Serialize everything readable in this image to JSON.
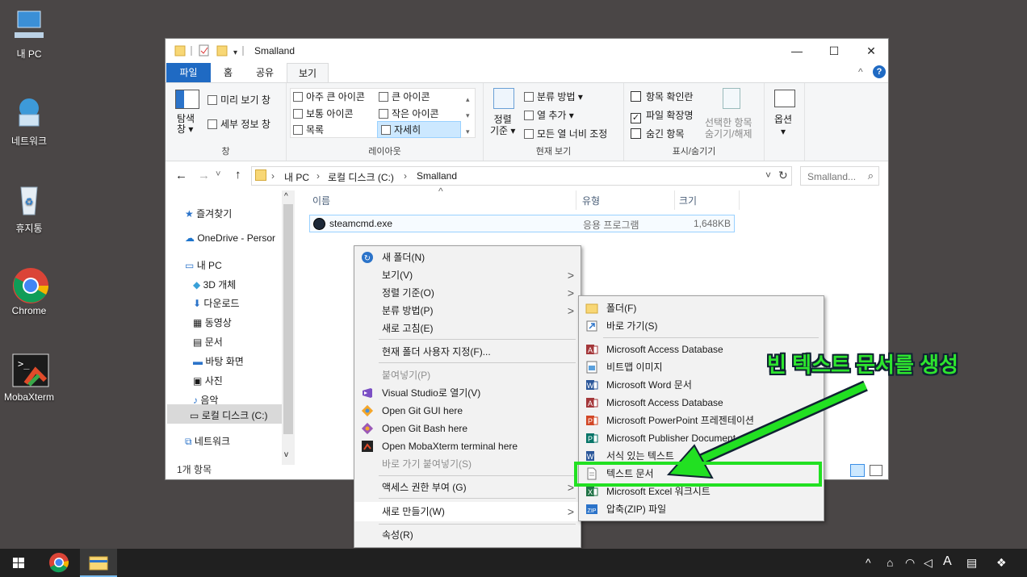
{
  "desktop": {
    "icons": [
      {
        "label": "내 PC"
      },
      {
        "label": "네트워크"
      },
      {
        "label": "휴지통"
      },
      {
        "label": "Chrome"
      },
      {
        "label": "MobaXterm"
      }
    ]
  },
  "window": {
    "title": "Smalland",
    "controls": {
      "minimize": "—",
      "maximize": "☐",
      "close": "✕"
    },
    "tabs": {
      "file": "파일",
      "home": "홈",
      "share": "공유",
      "view": "보기"
    },
    "ribbon": {
      "pane": {
        "nav_pane": "탐색\n창 ▾",
        "preview": "미리 보기 창",
        "details": "세부 정보 창",
        "label": "창"
      },
      "layout": {
        "items": [
          "아주 큰 아이콘",
          "큰 아이콘",
          "보통 아이콘",
          "작은 아이콘",
          "목록",
          "자세히"
        ],
        "label": "레이아웃"
      },
      "current_view": {
        "sort": "정렬\n기준 ▾",
        "group": "분류 방법 ▾",
        "add_col": "열 추가 ▾",
        "fit_cols": "모든 열 너비 조정",
        "label": "현재 보기"
      },
      "show_hide": {
        "item_check": "항목 확인란",
        "file_ext": "파일 확장명",
        "hidden": "숨긴 항목",
        "hide_selected": "선택한 항목\n숨기기/해제",
        "label": "표시/숨기기"
      },
      "options": {
        "label": "옵션\n▾"
      }
    },
    "address": {
      "path": [
        "내 PC",
        "로컬 디스크 (C:)",
        "Smalland"
      ],
      "search_placeholder": "Smalland...",
      "refresh": "↻"
    },
    "nav": [
      {
        "label": "즐겨찾기"
      },
      {
        "label": "OneDrive - Persor"
      },
      {
        "label": "내 PC"
      },
      {
        "label": "3D 개체"
      },
      {
        "label": "다운로드"
      },
      {
        "label": "동영상"
      },
      {
        "label": "문서"
      },
      {
        "label": "바탕 화면"
      },
      {
        "label": "사진"
      },
      {
        "label": "음악"
      },
      {
        "label": "로컬 디스크 (C:)"
      },
      {
        "label": "네트워크"
      }
    ],
    "columns": {
      "name": "이름",
      "type": "유형",
      "size": "크기"
    },
    "files": [
      {
        "name": "steamcmd.exe",
        "type": "응용 프로그램",
        "size": "1,648KB"
      }
    ],
    "status": "1개 항목"
  },
  "context_menu": {
    "items": [
      {
        "label": "새 폴더(N)"
      },
      {
        "label": "보기(V)"
      },
      {
        "label": "정렬 기준(O)"
      },
      {
        "label": "분류 방법(P)"
      },
      {
        "label": "새로 고침(E)"
      },
      {
        "label": "현재 폴더 사용자 지정(F)..."
      },
      {
        "label": "붙여넣기(P)"
      },
      {
        "label": "Visual Studio로 열기(V)"
      },
      {
        "label": "Open Git GUI here"
      },
      {
        "label": "Open Git Bash here"
      },
      {
        "label": "Open MobaXterm terminal here"
      },
      {
        "label": "바로 가기 붙여넣기(S)"
      },
      {
        "label": "액세스 권한 부여 (G)"
      },
      {
        "label": "새로 만들기(W)"
      },
      {
        "label": "속성(R)"
      }
    ]
  },
  "submenu": {
    "items": [
      {
        "label": "폴더(F)"
      },
      {
        "label": "바로 가기(S)"
      },
      {
        "label": "Microsoft Access Database"
      },
      {
        "label": "비트맵 이미지"
      },
      {
        "label": "Microsoft Word 문서"
      },
      {
        "label": "Microsoft Access Database"
      },
      {
        "label": "Microsoft PowerPoint 프레젠테이션"
      },
      {
        "label": "Microsoft Publisher Document"
      },
      {
        "label": "서식 있는 텍스트"
      },
      {
        "label": "텍스트 문서"
      },
      {
        "label": "Microsoft Excel 워크시트"
      },
      {
        "label": "압축(ZIP) 파일"
      }
    ]
  },
  "annotation": {
    "text": "빈 텍스트 문서를 생성",
    "color": "#2ee52e"
  },
  "taskbar": {
    "tray_lang": "A",
    "tray_expand": "^"
  }
}
